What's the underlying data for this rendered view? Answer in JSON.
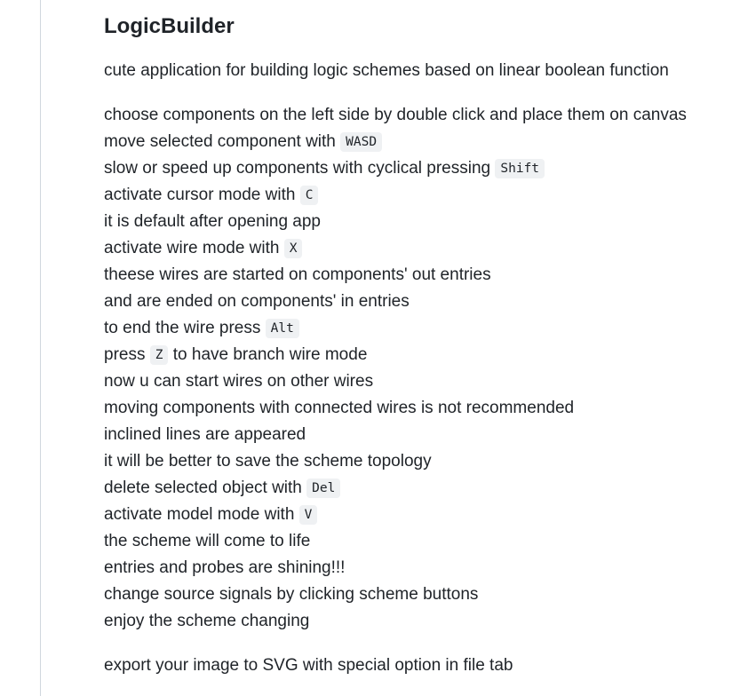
{
  "readme": {
    "title": "LogicBuilder",
    "tagline": "cute application for building logic schemes based on linear boolean function",
    "lines": [
      {
        "text": "choose components on the left side by double click and place them on canvas"
      },
      {
        "before": "move selected component with ",
        "code": "WASD",
        "after": ""
      },
      {
        "before": "slow or speed up components with cyclical pressing ",
        "code": "Shift",
        "after": ""
      },
      {
        "before": "activate cursor mode with ",
        "code": "C",
        "after": ""
      },
      {
        "text": "it is default after opening app"
      },
      {
        "before": "activate wire mode with ",
        "code": "X",
        "after": ""
      },
      {
        "text": "theese wires are started on components' out entries"
      },
      {
        "text": "and are ended on components' in entries"
      },
      {
        "before": "to end the wire press ",
        "code": "Alt",
        "after": ""
      },
      {
        "before": "press ",
        "code": "Z",
        "after": " to have branch wire mode"
      },
      {
        "text": "now u can start wires on other wires"
      },
      {
        "text": "moving components with connected wires is not recommended"
      },
      {
        "text": "inclined lines are appeared"
      },
      {
        "text": "it will be better to save the scheme topology"
      },
      {
        "before": "delete selected object with ",
        "code": "Del",
        "after": ""
      },
      {
        "before": "activate model mode with ",
        "code": "V",
        "after": ""
      },
      {
        "text": "the scheme will come to life"
      },
      {
        "text": "entries and probes are shining!!!"
      },
      {
        "text": "change source signals by clicking scheme buttons"
      },
      {
        "text": "enjoy the scheme changing"
      }
    ],
    "export_line": "export your image to SVG with special option in file tab"
  }
}
